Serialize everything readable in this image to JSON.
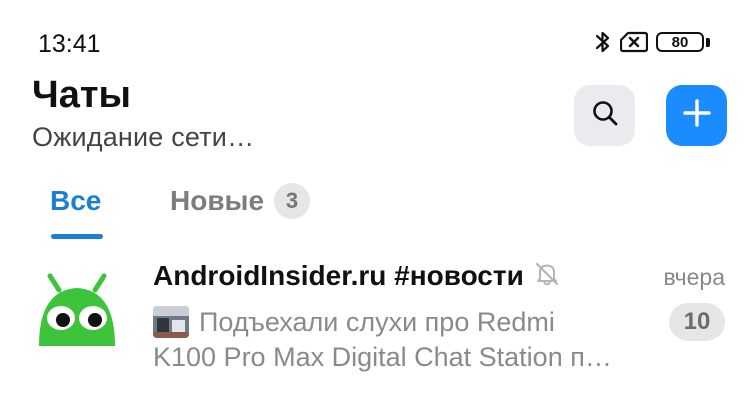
{
  "status_bar": {
    "time": "13:41",
    "battery_level": "80",
    "icons": [
      "bluetooth-icon",
      "no-sim-icon",
      "battery-icon"
    ]
  },
  "header": {
    "title": "Чаты",
    "subtitle": "Ожидание сети…",
    "search_icon": "search-icon",
    "add_icon": "plus-icon",
    "accent_color": "#1a8cff"
  },
  "tabs": [
    {
      "label": "Все",
      "active": true
    },
    {
      "label": "Новые",
      "badge": "3",
      "active": false
    }
  ],
  "chats": [
    {
      "name": "AndroidInsider.ru #новости",
      "muted": true,
      "time": "вчера",
      "preview_line1": "Подъехали слухи про Redmi",
      "preview_line2": "K100 Pro Max Digital Chat Station п…",
      "unread_count": "10",
      "avatar_color": "#3ec43a"
    }
  ]
}
